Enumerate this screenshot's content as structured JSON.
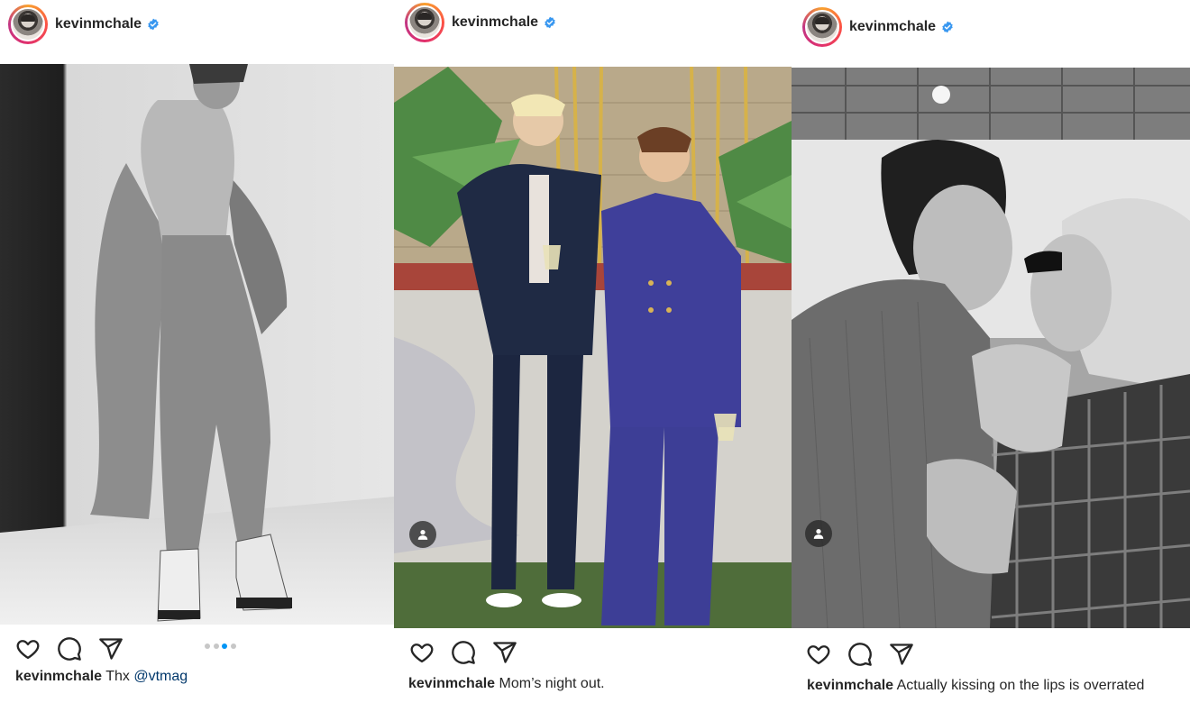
{
  "posts": [
    {
      "username": "kevinmchale",
      "verified": true,
      "carousel": {
        "count": 4,
        "active_index": 2
      },
      "caption": {
        "user": "kevinmchale",
        "text": "Thx",
        "mention": "@vtmag"
      },
      "has_tag_badge": false
    },
    {
      "username": "kevinmchale",
      "verified": true,
      "caption": {
        "user": "kevinmchale",
        "text": "Mom’s night out."
      },
      "has_tag_badge": true
    },
    {
      "username": "kevinmchale",
      "verified": true,
      "caption": {
        "user": "kevinmchale",
        "text": "Actually kissing on the lips is overrated"
      },
      "has_tag_badge": true
    }
  ],
  "icons": {
    "like": "heart-icon",
    "comment": "comment-icon",
    "share": "paper-plane-icon",
    "verified": "verified-badge-icon",
    "tagged": "user-tag-icon"
  },
  "colors": {
    "verified_blue": "#3897f0",
    "active_dot": "#0095f6",
    "mention": "#00376b",
    "text": "#262626"
  }
}
